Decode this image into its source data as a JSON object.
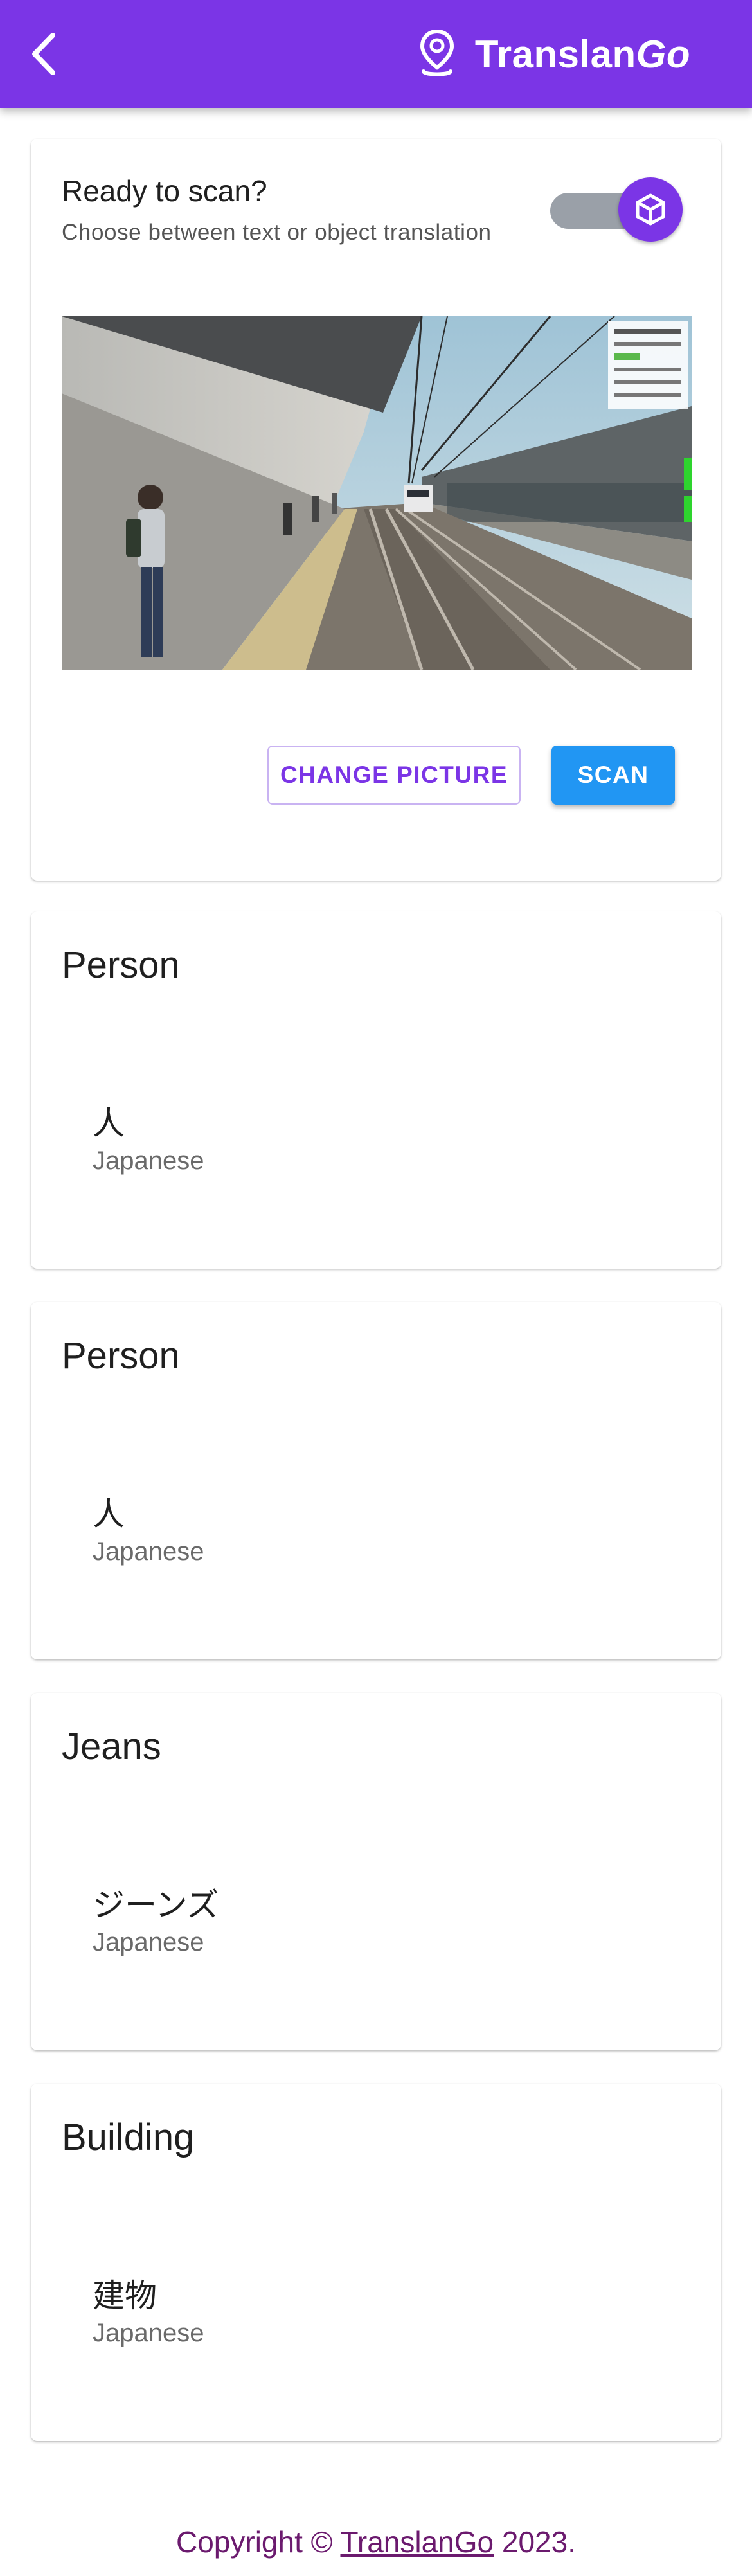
{
  "app": {
    "title_main": "Translan",
    "title_accent": "Go",
    "accent_color": "#7b35e6",
    "back_icon": "chevron-left-icon",
    "logo_icon": "map-pin-icon"
  },
  "scan_card": {
    "title": "Ready to scan?",
    "subtitle": "Choose between text or object translation",
    "mode_toggle_icon": "cube-icon",
    "image_description": "Train station platform with a train approaching",
    "change_picture_label": "CHANGE PICTURE",
    "scan_label": "SCAN",
    "scan_color": "#2196f3"
  },
  "results": [
    {
      "object": "Person",
      "translation": "人",
      "language": "Japanese"
    },
    {
      "object": "Person",
      "translation": "人",
      "language": "Japanese"
    },
    {
      "object": "Jeans",
      "translation": "ジーンズ",
      "language": "Japanese"
    },
    {
      "object": "Building",
      "translation": "建物",
      "language": "Japanese"
    }
  ],
  "footer": {
    "prefix": "Copyright © ",
    "link": "TranslanGo",
    "suffix": " 2023."
  }
}
